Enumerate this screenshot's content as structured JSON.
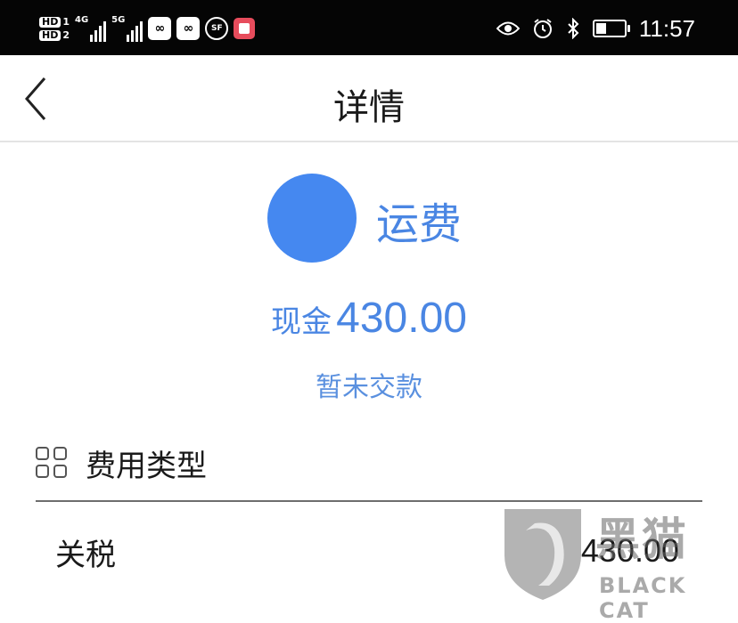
{
  "status_bar": {
    "sim1": "HD",
    "sim1_index": "1",
    "sim2": "HD",
    "sim2_index": "2",
    "network1": "4G",
    "network2": "5G",
    "sf_icon_text": "SF",
    "time": "11:57",
    "battery_level": 0.35,
    "icons": [
      "signal-icon",
      "app-link-icon",
      "sf-express-icon",
      "notes-icon",
      "eye-icon",
      "alarm-icon",
      "bluetooth-icon",
      "battery-icon"
    ]
  },
  "header": {
    "title": "详情"
  },
  "summary": {
    "category": "运费",
    "payment_method": "现金",
    "amount": "430.00",
    "status": "暂未交款",
    "accent_color": "#4588f0"
  },
  "fee_section": {
    "label": "费用类型",
    "items": [
      {
        "name": "关税",
        "amount": "430.00"
      }
    ]
  },
  "watermark": {
    "cn": "黑猫",
    "en": "BLACK CAT"
  }
}
